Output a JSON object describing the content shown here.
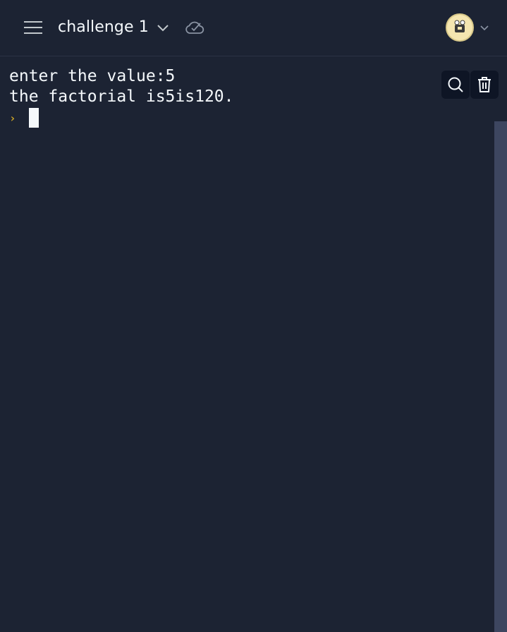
{
  "header": {
    "title": "challenge 1",
    "menu_icon": "hamburger-menu-icon",
    "dropdown_icon": "chevron-down-icon",
    "sync_icon": "cloud-check-icon",
    "avatar_icon": "user-avatar-icon"
  },
  "console": {
    "lines": [
      "enter the value:5",
      "the factorial is5is120."
    ],
    "prompt_symbol": "›",
    "prompt_color": "#c9a227"
  },
  "toolbar": {
    "search_icon": "search-icon",
    "clear_icon": "trash-icon"
  },
  "colors": {
    "background": "#1c2333",
    "text": "#f5f9fc",
    "tool_button_bg": "#0e1525",
    "scrollbar": "#3d4660"
  }
}
